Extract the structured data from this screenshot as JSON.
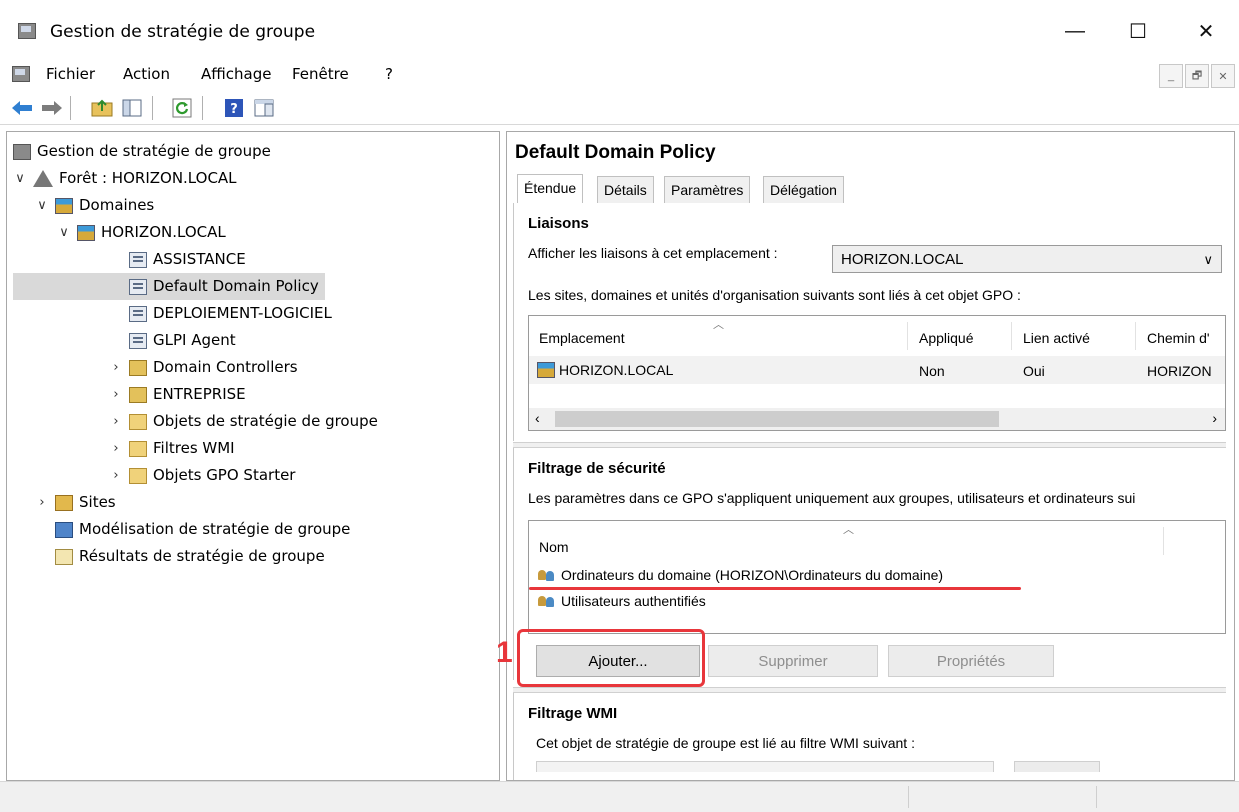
{
  "window": {
    "title": "Gestion de stratégie de groupe"
  },
  "window_controls": {
    "minimize": "—",
    "maximize": "☐",
    "close": "✕"
  },
  "menu": [
    "Fichier",
    "Action",
    "Affichage",
    "Fenêtre",
    "?"
  ],
  "mdi_controls": {
    "minimize": "_",
    "restore": "🗗",
    "close": "✕"
  },
  "toolbar": [
    "back-icon",
    "forward-icon",
    "up-folder-icon",
    "show-hide-tree-icon",
    "refresh-icon",
    "help-icon",
    "console-tree-icon"
  ],
  "tree": [
    {
      "level": 0,
      "icon": "console",
      "label": "Gestion de stratégie de groupe",
      "chevron": ""
    },
    {
      "level": 0,
      "icon": "forest",
      "label": "Forêt : HORIZON.LOCAL",
      "chevron": "∨"
    },
    {
      "level": 1,
      "icon": "domain",
      "label": "Domaines",
      "chevron": "∨"
    },
    {
      "level": 2,
      "icon": "domain",
      "label": "HORIZON.LOCAL",
      "chevron": "∨"
    },
    {
      "level": 3,
      "icon": "gpo",
      "label": "ASSISTANCE",
      "chevron": ""
    },
    {
      "level": 3,
      "icon": "gpo",
      "label": "Default Domain Policy",
      "chevron": "",
      "selected": true
    },
    {
      "level": 3,
      "icon": "gpo",
      "label": "DEPLOIEMENT-LOGICIEL",
      "chevron": ""
    },
    {
      "level": 3,
      "icon": "gpo",
      "label": "GLPI Agent",
      "chevron": ""
    },
    {
      "level": 3,
      "icon": "ou",
      "label": "Domain Controllers",
      "chevron": "›"
    },
    {
      "level": 3,
      "icon": "ou",
      "label": "ENTREPRISE",
      "chevron": "›"
    },
    {
      "level": 3,
      "icon": "folder",
      "label": "Objets de stratégie de groupe",
      "chevron": "›"
    },
    {
      "level": 3,
      "icon": "folder",
      "label": "Filtres WMI",
      "chevron": "›"
    },
    {
      "level": 3,
      "icon": "folder",
      "label": "Objets GPO Starter",
      "chevron": "›"
    },
    {
      "level": 1,
      "icon": "sites",
      "label": "Sites",
      "chevron": "›"
    },
    {
      "level": 1,
      "icon": "model",
      "label": "Modélisation de stratégie de groupe",
      "chevron": ""
    },
    {
      "level": 1,
      "icon": "result",
      "label": "Résultats de stratégie de groupe",
      "chevron": ""
    }
  ],
  "pane": {
    "title": "Default Domain Policy",
    "tabs": [
      "Étendue",
      "Détails",
      "Paramètres",
      "Délégation"
    ],
    "links": {
      "heading": "Liaisons",
      "location_label": "Afficher les liaisons à cet emplacement :",
      "location_value": "HORIZON.LOCAL",
      "description": "Les sites, domaines et unités d'organisation suivants sont liés à cet objet GPO :",
      "columns": [
        "Emplacement",
        "Appliqué",
        "Lien activé",
        "Chemin d'"
      ],
      "rows": [
        {
          "location": "HORIZON.LOCAL",
          "applied": "Non",
          "enabled": "Oui",
          "path": "HORIZON"
        }
      ]
    },
    "security": {
      "heading": "Filtrage de sécurité",
      "description": "Les paramètres dans ce GPO s'appliquent uniquement aux groupes, utilisateurs et ordinateurs sui",
      "column": "Nom",
      "items": [
        "Ordinateurs du domaine (HORIZON\\Ordinateurs du domaine)",
        "Utilisateurs authentifiés"
      ],
      "buttons": {
        "add": "Ajouter...",
        "remove": "Supprimer",
        "properties": "Propriétés"
      },
      "annotation": "1"
    },
    "wmi": {
      "heading": "Filtrage WMI",
      "description": "Cet objet de stratégie de groupe est lié au filtre WMI suivant :"
    }
  },
  "colors": {
    "highlight": "#e8363b",
    "selection": "#d9d9d9"
  }
}
